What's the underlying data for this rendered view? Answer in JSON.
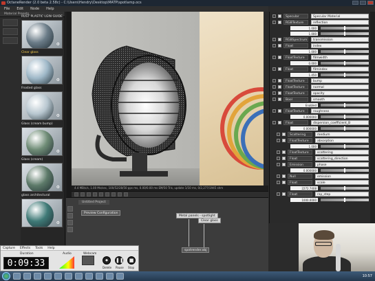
{
  "window": {
    "title": "OctaneRender (2.0 beta 2.58c) - C:\\Users\\Hendry\\Desktop\\MATP\\spotlamp.ocs",
    "controls": [
      "minimize",
      "maximize",
      "close"
    ]
  },
  "menu": {
    "items": [
      "File",
      "Edit",
      "Node",
      "Help"
    ]
  },
  "left_panel": {
    "tab": "Material Presets",
    "materials": [
      {
        "label": "RUST PLASTIC LGIN GUIDE",
        "color": "#6b7c88",
        "selected": false
      },
      {
        "label": "Clear glass",
        "color": "#9fb8c8",
        "selected": true
      },
      {
        "label": "Frosted glass",
        "color": "#b7c6cf",
        "selected": false
      },
      {
        "label": "Glass (cream bump)",
        "color": "#6f8c76",
        "selected": false
      },
      {
        "label": "Glass (cream)",
        "color": "#5d7a69",
        "selected": false
      },
      {
        "label": "glass architectural",
        "color": "#3f7a77",
        "selected": false
      }
    ]
  },
  "viewport": {
    "status": "4.4 MB/s/s, 1.00 Ms/sec, 100/52/28/50 pps ms, 0.00/0.00 ms  EM/50 Tris, update 1/10 ms, 0/2,277/1945 shm"
  },
  "node_graph": {
    "tab": "Untitled Project",
    "nodes": {
      "preview": "Preview Configuration",
      "metal": "Metal panels - spotlight",
      "clear": "Clear glass",
      "output": "spotrender.obj"
    }
  },
  "properties": {
    "rows": [
      {
        "kind": "node",
        "type": "Specular",
        "name": "Specular Material"
      },
      {
        "kind": "node",
        "type": "RGBTexture",
        "name": "reflection"
      },
      {
        "kind": "value",
        "value": "1.000"
      },
      {
        "kind": "value",
        "value": "1.000"
      },
      {
        "kind": "node",
        "type": "RGBSpectrum",
        "name": "transmission"
      },
      {
        "kind": "node",
        "type": "Float",
        "name": "index"
      },
      {
        "kind": "value",
        "value": "1.000"
      },
      {
        "kind": "node",
        "type": "FloatTexture",
        "name": "filmwidth"
      },
      {
        "kind": "value",
        "value": "0.000"
      },
      {
        "kind": "node",
        "type": "Float",
        "name": "filmindex"
      },
      {
        "kind": "value",
        "value": "1.450"
      },
      {
        "kind": "node",
        "type": "FloatTexture",
        "name": "bump"
      },
      {
        "kind": "node",
        "type": "FloatTexture",
        "name": "normal"
      },
      {
        "kind": "node",
        "type": "FloatTexture",
        "name": "opacity"
      },
      {
        "kind": "node",
        "type": "Bool",
        "name": "smooth"
      },
      {
        "kind": "value",
        "value": "Enabled"
      },
      {
        "kind": "node",
        "type": "FloatTexture",
        "name": "roughness"
      },
      {
        "kind": "value",
        "value": "0.000000"
      },
      {
        "kind": "node",
        "type": "Float",
        "name": "dispersion_coefficient_B"
      },
      {
        "kind": "value",
        "value": "0.000000"
      },
      {
        "kind": "node",
        "type": "Scattering",
        "name": "medium"
      },
      {
        "kind": "node",
        "type": "FloatTexture",
        "name": "absorption"
      },
      {
        "kind": "value",
        "value": "1.000"
      },
      {
        "kind": "node",
        "type": "FloatTexture",
        "name": "scattering"
      },
      {
        "kind": "node",
        "type": "Float",
        "name": "scattering_direction"
      },
      {
        "kind": "node",
        "type": "Emission",
        "name": "phase"
      },
      {
        "kind": "value",
        "value": "0.000000"
      },
      {
        "kind": "node",
        "type": "Null emission",
        "name": "emission"
      },
      {
        "kind": "node",
        "type": "Float",
        "name": "scale"
      },
      {
        "kind": "value",
        "value": "2272.7408"
      },
      {
        "kind": "node",
        "type": "Float",
        "name": "ray_step"
      },
      {
        "kind": "value",
        "value": "1000.0000"
      }
    ]
  },
  "capture": {
    "menu": [
      "Capture",
      "Effects",
      "Tools",
      "Help"
    ],
    "duration_label": "Duration",
    "time": "0:09:33",
    "audio_label": "Audio",
    "webcam_label": "Webcam",
    "buttons": [
      "Delete",
      "Pause",
      "Stop"
    ]
  },
  "taskbar": {
    "clock": "10:57"
  }
}
